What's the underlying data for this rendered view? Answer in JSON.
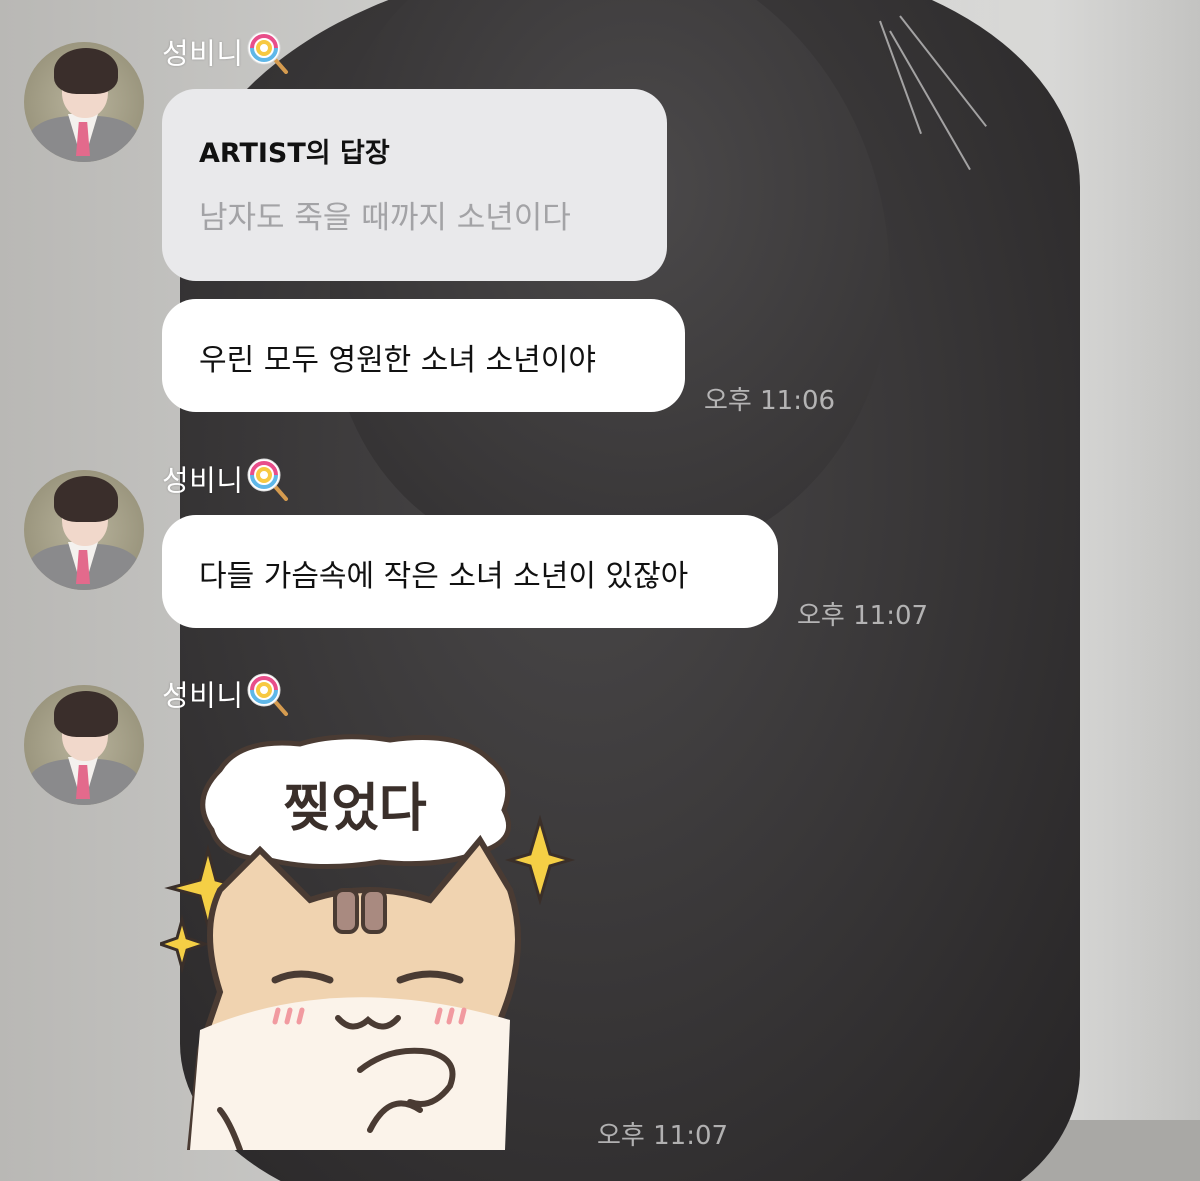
{
  "colors": {
    "bubble_bg": "#ffffff",
    "reply_bubble_bg": "#e9e9eb",
    "reply_quote_text": "#a3a3a6",
    "time_text": "rgba(255,255,255,0.62)"
  },
  "messages": [
    {
      "sender": "성비니",
      "sender_icon": "lollipop-icon",
      "reply": {
        "label": "ARTIST의 답장",
        "quote": "남자도 죽을 때까지 소년이다"
      },
      "text": "우린 모두 영원한 소녀 소년이야",
      "time": "오후 11:06"
    },
    {
      "sender": "성비니",
      "sender_icon": "lollipop-icon",
      "text": "다들 가슴속에 작은 소녀 소년이 있잖아",
      "time": "오후 11:07"
    },
    {
      "sender": "성비니",
      "sender_icon": "lollipop-icon",
      "sticker": {
        "icon": "cat-sticker",
        "text": "찢었다"
      },
      "time": "오후 11:07"
    }
  ]
}
